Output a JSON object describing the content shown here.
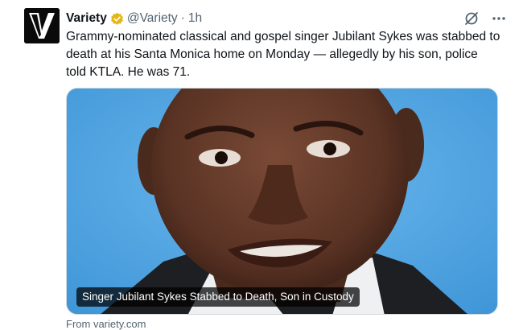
{
  "author": {
    "display_name": "Variety",
    "handle": "@Variety",
    "separator": "·",
    "timestamp": "1h",
    "avatar_icon": "variety-logo",
    "verified_icon": "verified-gold-badge-icon"
  },
  "actions": {
    "grok_icon": "grok-icon",
    "more_icon": "more-horizontal-icon"
  },
  "tweet": {
    "text": "Grammy-nominated classical and gospel singer Jubilant Sykes was stabbed to death at his Santa Monica home on Monday — allegedly by his son, police told KTLA. He was 71."
  },
  "card": {
    "title": "Singer Jubilant Sykes Stabbed to Death, Son in Custody",
    "domain": "From variety.com"
  },
  "colors": {
    "accent_gold": "#e2b719",
    "secondary_text": "#536471",
    "photo_background": "#4ea6e6"
  }
}
